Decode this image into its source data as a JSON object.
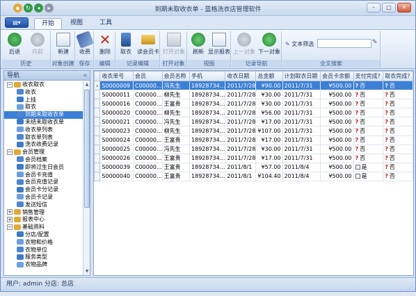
{
  "window": {
    "title": "到期未取收衣单 - 蓝格洗衣店管理软件"
  },
  "tabs": [
    "开始",
    "视图",
    "工具"
  ],
  "ribbon": {
    "history": {
      "label": "历史",
      "back": "后退",
      "forward": "向前"
    },
    "create": {
      "label": "对象创建",
      "new": "新建"
    },
    "save": {
      "label": "保存",
      "collect": "收费"
    },
    "edit": {
      "label": "编辑",
      "delete": "删除"
    },
    "record": {
      "label": "记录编辑",
      "take": "取衣",
      "readcard": "读会员卡"
    },
    "open": {
      "label": "打开对象",
      "open_obj": "打开对象"
    },
    "view": {
      "label": "视图",
      "refresh": "刷新",
      "show_report": "显示报表"
    },
    "nav": {
      "label": "记录导航",
      "prev": "上一对象",
      "next": "下一对象"
    },
    "search": {
      "label": "全文搜索",
      "text_filter": "文本筛选"
    }
  },
  "nav": {
    "header": "导航",
    "items": [
      {
        "label": "收衣取衣",
        "level": 0,
        "expanded": true
      },
      {
        "label": "收衣",
        "level": 1
      },
      {
        "label": "上挂",
        "level": 1
      },
      {
        "label": "取衣",
        "level": 1
      },
      {
        "label": "到期未取收衣单",
        "level": 1,
        "selected": true
      },
      {
        "label": "未结未取收衣单",
        "level": 1
      },
      {
        "label": "收衣单列表",
        "level": 1
      },
      {
        "label": "取衣单列表",
        "level": 1
      },
      {
        "label": "洗衣收费记录",
        "level": 1
      },
      {
        "label": "会员管理",
        "level": 0,
        "expanded": true
      },
      {
        "label": "会员档案",
        "level": 1
      },
      {
        "label": "即将过生日会员",
        "level": 1
      },
      {
        "label": "会员卡充值",
        "level": 1
      },
      {
        "label": "会员充值记录",
        "level": 1
      },
      {
        "label": "会员卡分记录",
        "level": 1
      },
      {
        "label": "会员卡记录",
        "level": 1
      },
      {
        "label": "发送短信",
        "level": 1
      },
      {
        "label": "销售管理",
        "level": 0,
        "expanded": false
      },
      {
        "label": "报表中心",
        "level": 0,
        "expanded": false
      },
      {
        "label": "基础资料",
        "level": 0,
        "expanded": true
      },
      {
        "label": "分店/配置",
        "level": 1
      },
      {
        "label": "衣物和价格",
        "level": 1
      },
      {
        "label": "衣物单位",
        "level": 1
      },
      {
        "label": "服务类型",
        "level": 1
      },
      {
        "label": "衣物品牌",
        "level": 1
      }
    ]
  },
  "grid": {
    "columns": [
      "收衣单号",
      "会员",
      "会员名称",
      "手机",
      "收衣日期",
      "总金额",
      "计划取衣日期",
      "会员卡余额",
      "支付完成?",
      "取衣完成?"
    ],
    "rows": [
      [
        "S0000009",
        "C00000...",
        "冯先生",
        "18928734...",
        "2011/7/28",
        "¥90.00",
        "2011/7/31",
        "¥500.00",
        "否",
        "否"
      ],
      [
        "S0000011",
        "C00000...",
        "柳先生",
        "18928734...",
        "2011/7/28",
        "¥30.00",
        "2011/7/31",
        "¥500.00",
        "否",
        "否"
      ],
      [
        "S0000016",
        "C00000...",
        "王富贵",
        "18928734...",
        "2011/7/28",
        "¥30.00",
        "2011/7/31",
        "¥500.00",
        "否",
        "否"
      ],
      [
        "S0000020",
        "C00000...",
        "柳先生",
        "18928734...",
        "2011/7/28",
        "¥56.00",
        "2011/7/31",
        "¥500.00",
        "否",
        "否"
      ],
      [
        "S0000021",
        "C00000...",
        "冯先生",
        "18928734...",
        "2011/7/28",
        "¥17.00",
        "2011/7/31",
        "¥500.00",
        "否",
        "否"
      ],
      [
        "S0000023",
        "C00000...",
        "柳先生",
        "18928734...",
        "2011/7/28",
        "¥107.00",
        "2011/7/31",
        "¥500.00",
        "否",
        "否"
      ],
      [
        "S0000024",
        "C00000...",
        "王富贵",
        "18928734...",
        "2011/7/28",
        "¥17.00",
        "2011/7/31",
        "¥500.00",
        "否",
        "否"
      ],
      [
        "S0000025",
        "C00000...",
        "冯先生",
        "18928734...",
        "2011/7/28",
        "¥30.00",
        "2011/7/31",
        "¥500.00",
        "否",
        "否"
      ],
      [
        "S0000026",
        "C00000...",
        "王富贵",
        "18928734...",
        "2011/7/28",
        "¥17.00",
        "2011/7/31",
        "¥500.00",
        "否",
        "否"
      ],
      [
        "S0000039",
        "C00000...",
        "王富贵",
        "18928734...",
        "2011/8/1",
        "¥57.00",
        "2011/8/4",
        "¥500.00",
        "是",
        "否"
      ],
      [
        "S0000040",
        "C00000...",
        "王富贵",
        "18928734...",
        "2011/8/1",
        "¥104.40",
        "2011/8/4",
        "¥500.00",
        "是",
        "否"
      ]
    ]
  },
  "status": {
    "text": "用户: admin  分店: 总店"
  },
  "colors": {
    "accent": "#3c7fd6",
    "title_bg": "#c8d8ee",
    "warn": "#d01010"
  }
}
